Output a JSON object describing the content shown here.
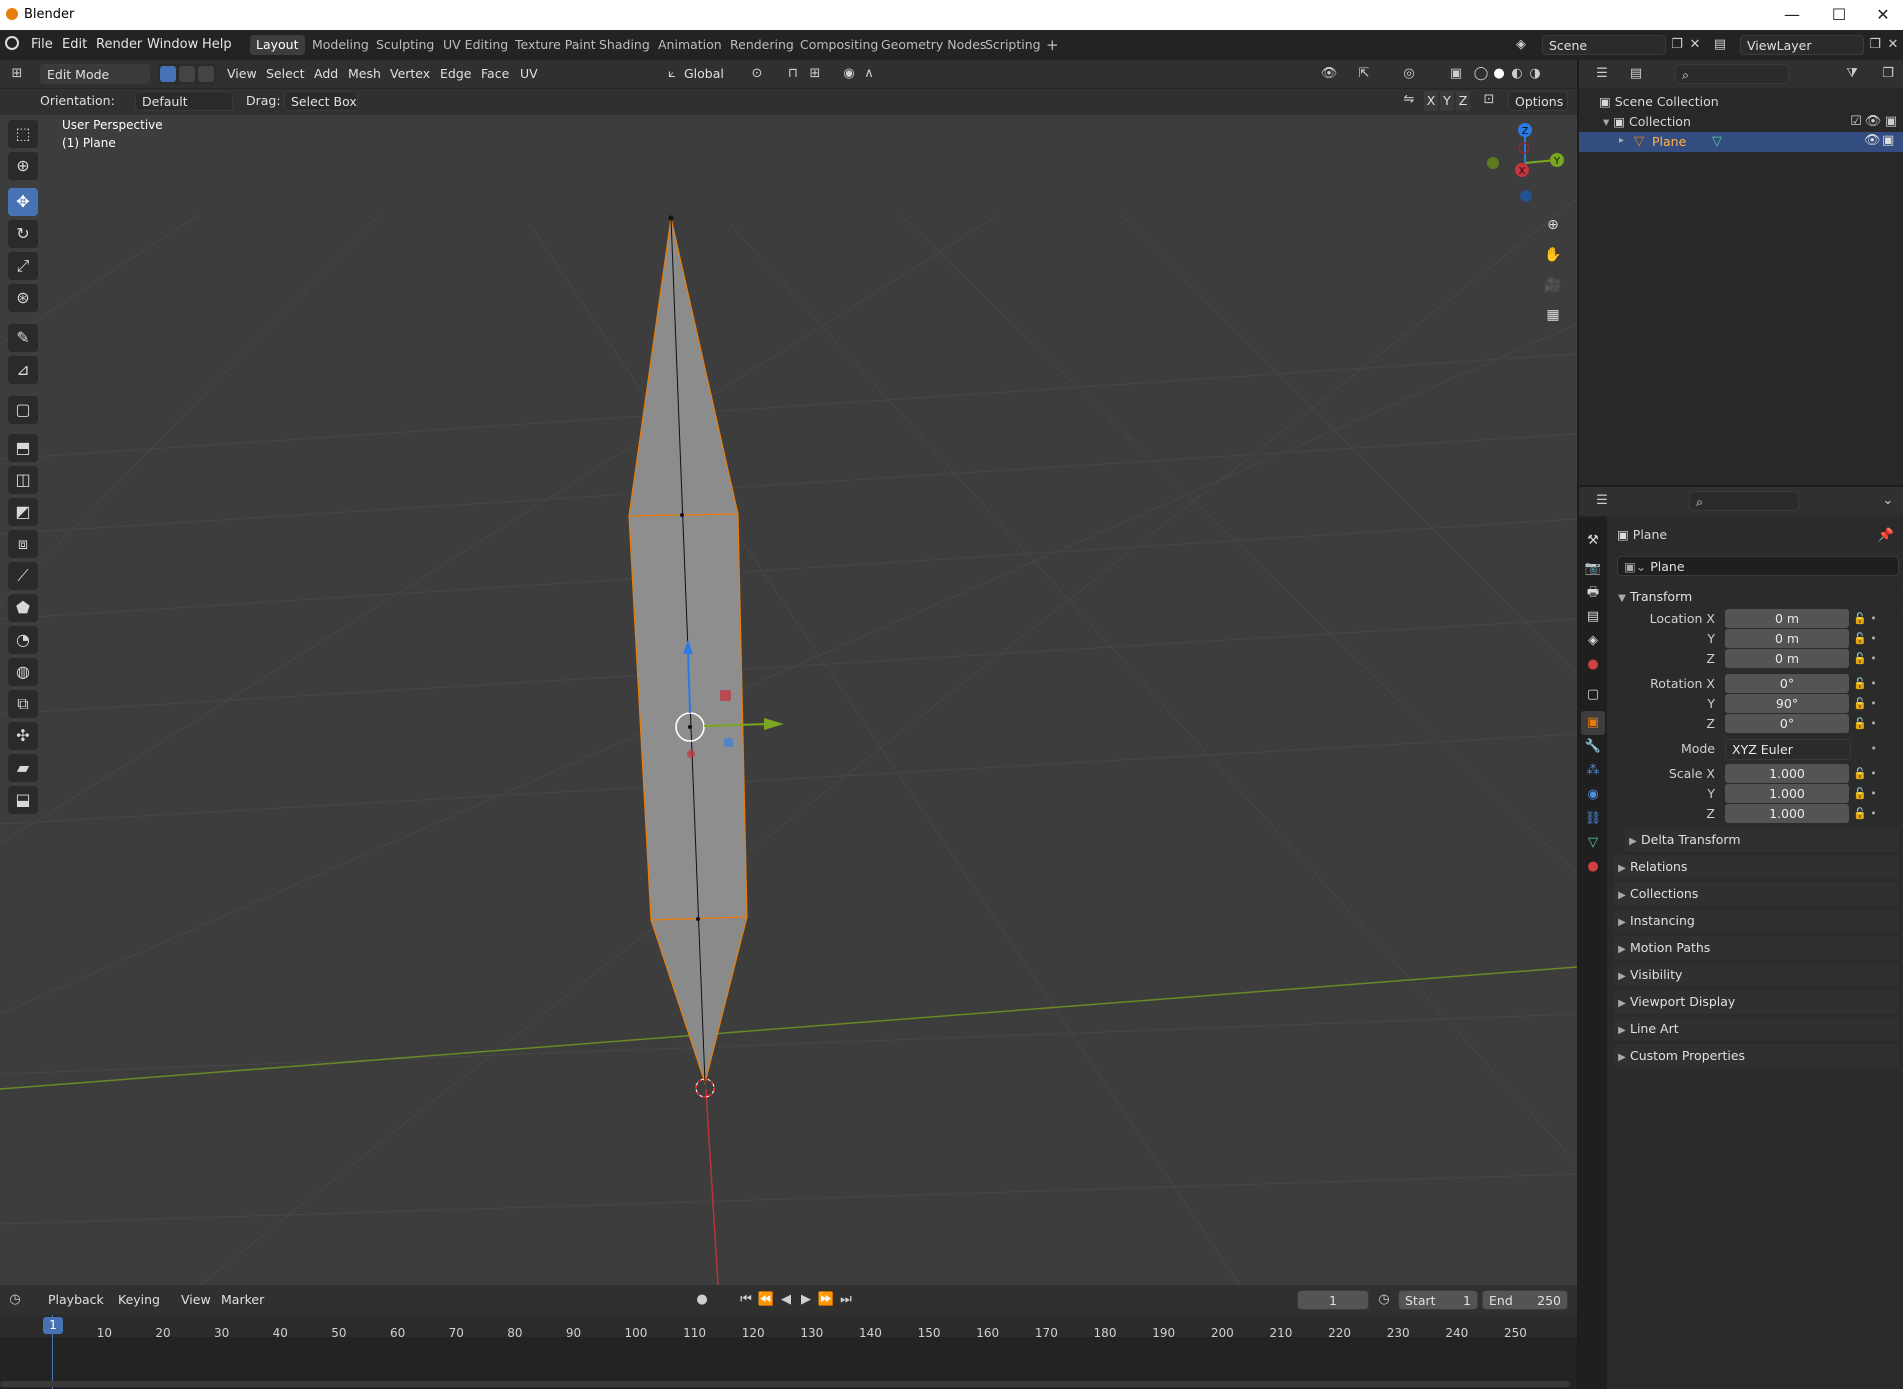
{
  "window": {
    "title": "Blender",
    "minimize": "—",
    "maximize": "☐",
    "close": "✕"
  },
  "menus": [
    "File",
    "Edit",
    "Render",
    "Window",
    "Help"
  ],
  "workspaces": [
    "Layout",
    "Modeling",
    "Sculpting",
    "UV Editing",
    "Texture Paint",
    "Shading",
    "Animation",
    "Rendering",
    "Compositing",
    "Geometry Nodes",
    "Scripting",
    "+"
  ],
  "scene": {
    "name": "Scene",
    "view_layer": "ViewLayer"
  },
  "viewport_header": {
    "mode": "Edit Mode",
    "menus": [
      "View",
      "Select",
      "Add",
      "Mesh",
      "Vertex",
      "Edge",
      "Face",
      "UV"
    ],
    "transform_orientation": "Global"
  },
  "tool_header": {
    "orientation_label": "Orientation:",
    "orientation_value": "Default",
    "drag_label": "Drag:",
    "drag_value": "Select Box",
    "axes": [
      "X",
      "Y",
      "Z"
    ],
    "options_label": "Options"
  },
  "viewport_overlay": {
    "perspective": "User Perspective",
    "object": "(1) Plane"
  },
  "gizmo_axes": {
    "x": "X",
    "y": "Y",
    "z": "Z"
  },
  "outliner": {
    "search_placeholder": "",
    "root": "Scene Collection",
    "collection": "Collection",
    "object": "Plane"
  },
  "properties": {
    "object_name": "Plane",
    "data_name": "Plane",
    "transform_title": "Transform",
    "location_label": "Location X",
    "rotation_label": "Rotation X",
    "scale_label": "Scale X",
    "y_label": "Y",
    "z_label": "Z",
    "location": [
      "0 m",
      "0 m",
      "0 m"
    ],
    "rotation": [
      "0°",
      "90°",
      "0°"
    ],
    "mode_label": "Mode",
    "mode_value": "XYZ Euler",
    "scale": [
      "1.000",
      "1.000",
      "1.000"
    ],
    "delta_transform": "Delta Transform",
    "panels": [
      "Relations",
      "Collections",
      "Instancing",
      "Motion Paths",
      "Visibility",
      "Viewport Display",
      "Line Art",
      "Custom Properties"
    ]
  },
  "timeline": {
    "menus": [
      "Playback",
      "Keying",
      "View",
      "Marker"
    ],
    "current_frame": "1",
    "start_label": "Start",
    "start": "1",
    "end_label": "End",
    "end": "250",
    "ticks": [
      "1",
      "10",
      "20",
      "30",
      "40",
      "50",
      "60",
      "70",
      "80",
      "90",
      "100",
      "110",
      "120",
      "130",
      "140",
      "150",
      "160",
      "170",
      "180",
      "190",
      "200",
      "210",
      "220",
      "230",
      "240",
      "250"
    ]
  },
  "colors": {
    "accent": "#4772b3",
    "selection_orange": "#e87d0d",
    "x_axis": "#c8323c",
    "y_axis": "#7aa620",
    "z_axis": "#2b7be4"
  }
}
